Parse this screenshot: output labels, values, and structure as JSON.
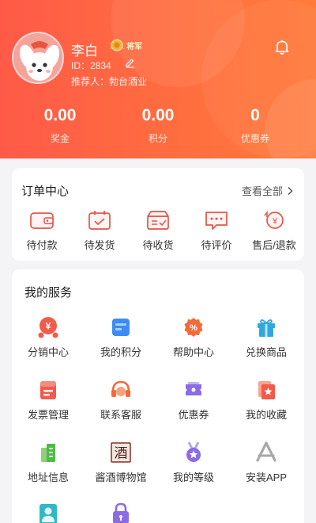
{
  "profile": {
    "name": "李白",
    "badge": "将军",
    "id_text": "ID：2834",
    "referrer_text": "推荐人：勃台酒业"
  },
  "stats": [
    {
      "value": "0.00",
      "label": "奖金"
    },
    {
      "value": "0.00",
      "label": "积分"
    },
    {
      "value": "0",
      "label": "优惠券"
    }
  ],
  "orders": {
    "title": "订单中心",
    "view_all": "查看全部",
    "items": [
      {
        "label": "待付款",
        "icon": "wallet-icon"
      },
      {
        "label": "待发货",
        "icon": "ship-box-icon"
      },
      {
        "label": "待收货",
        "icon": "receive-box-icon"
      },
      {
        "label": "待评价",
        "icon": "comment-icon"
      },
      {
        "label": "售后/退款",
        "icon": "refund-icon"
      }
    ]
  },
  "services": {
    "title": "我的服务",
    "items": [
      {
        "label": "分销中心",
        "icon": "distribution-icon"
      },
      {
        "label": "我的积分",
        "icon": "points-icon"
      },
      {
        "label": "帮助中心",
        "icon": "help-icon"
      },
      {
        "label": "兑换商品",
        "icon": "gift-icon"
      },
      {
        "label": "发票管理",
        "icon": "invoice-icon"
      },
      {
        "label": "联系客服",
        "icon": "headset-icon"
      },
      {
        "label": "优惠券",
        "icon": "coupon-icon"
      },
      {
        "label": "我的收藏",
        "icon": "favorite-icon"
      },
      {
        "label": "地址信息",
        "icon": "address-icon"
      },
      {
        "label": "酱酒博物馆",
        "icon": "museum-icon"
      },
      {
        "label": "我的等级",
        "icon": "medal-icon"
      },
      {
        "label": "安装APP",
        "icon": "app-store-icon"
      },
      {
        "label": "",
        "icon": "contact-card-icon"
      },
      {
        "label": "",
        "icon": "lock-icon"
      }
    ]
  },
  "colors": {
    "header_start": "#ff5a48",
    "header_end": "#ff7a3a",
    "accent": "#f25a4a"
  }
}
